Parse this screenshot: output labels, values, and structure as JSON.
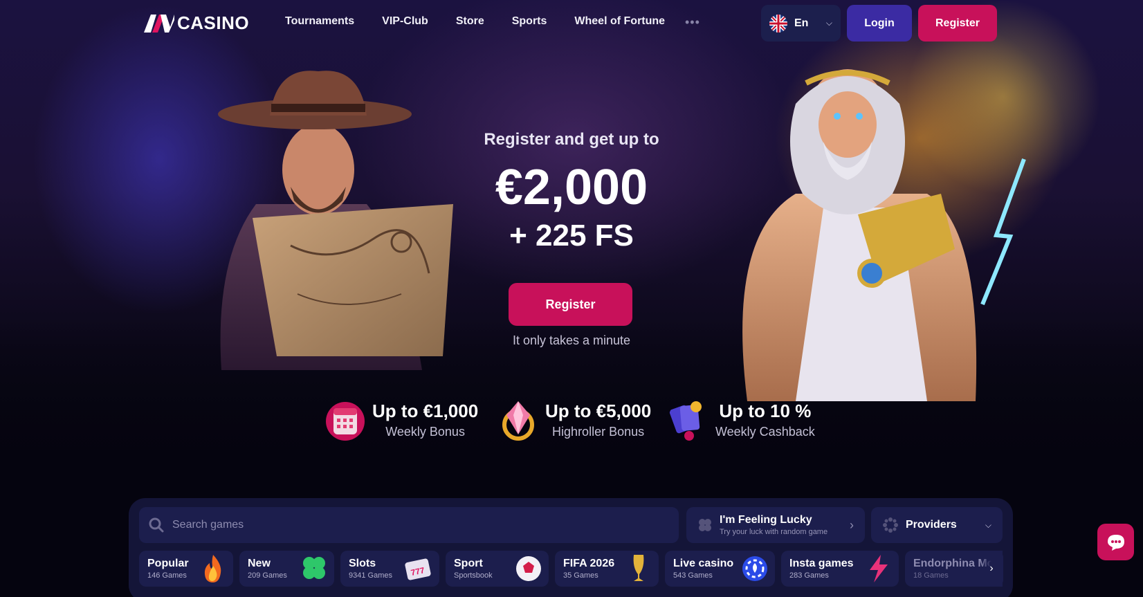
{
  "brand": {
    "logo_text": "CASINO",
    "accent_color": "#c8115a",
    "secondary_color": "#3b2ba3"
  },
  "nav": {
    "items": [
      "Tournaments",
      "VIP-Club",
      "Store",
      "Sports",
      "Wheel of Fortune"
    ],
    "more_icon": "ellipsis-icon"
  },
  "language": {
    "label": "En",
    "flag_icon": "uk-flag-icon"
  },
  "header_buttons": {
    "login": "Login",
    "register": "Register"
  },
  "hero": {
    "subtitle": "Register and get up to",
    "amount": "€2,000",
    "free_spins": "+ 225 FS",
    "cta": "Register",
    "note": "It only takes a minute"
  },
  "bonuses": [
    {
      "title": "Up to €1,000",
      "subtitle": "Weekly Bonus",
      "icon": "calendar-icon"
    },
    {
      "title": "Up to €5,000",
      "subtitle": "Highroller Bonus",
      "icon": "diamond-icon"
    },
    {
      "title": "Up to 10 %",
      "subtitle": "Weekly Cashback",
      "icon": "cards-icon"
    }
  ],
  "search": {
    "placeholder": "Search games"
  },
  "lucky": {
    "title": "I'm Feeling Lucky",
    "subtitle": "Try your luck with random game"
  },
  "providers": {
    "label": "Providers"
  },
  "categories": [
    {
      "name": "Popular",
      "count": "146 Games",
      "icon": "fire-icon"
    },
    {
      "name": "New",
      "count": "209 Games",
      "icon": "clover-icon"
    },
    {
      "name": "Slots",
      "count": "9341 Games",
      "icon": "slot-machine-icon"
    },
    {
      "name": "Sport",
      "count": "Sportsbook",
      "icon": "soccer-ball-icon"
    },
    {
      "name": "FIFA 2026",
      "count": "35 Games",
      "icon": "trophy-icon"
    },
    {
      "name": "Live casino",
      "count": "543 Games",
      "icon": "poker-chip-icon"
    },
    {
      "name": "Insta games",
      "count": "283 Games",
      "icon": "lightning-icon"
    },
    {
      "name": "Endorphina Mone",
      "count": "18 Games",
      "icon": "endorphina-icon"
    }
  ]
}
